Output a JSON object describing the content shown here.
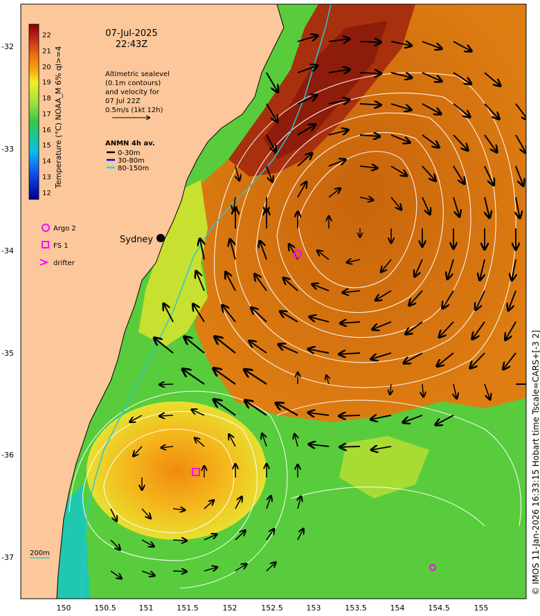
{
  "title": {
    "date": "07-Jul-2025",
    "time": "22:43Z"
  },
  "info": {
    "line1": "Altimetric sealevel",
    "line2": "(0.1m contours)",
    "line3": "and velocity for",
    "line4": "07 Jul 22Z",
    "scale": "0.5m/s (1kt 12h)"
  },
  "anmn": {
    "title": "ANMN 4h av.",
    "items": [
      {
        "label": "0-30m",
        "color": "#000000"
      },
      {
        "label": "30-80m",
        "color": "#0000ff"
      },
      {
        "label": "80-150m",
        "color": "#00e5e5"
      }
    ]
  },
  "colorbar": {
    "label": "Temperature (°C) NOAA_M 6% ql>=4",
    "ticks": [
      "22",
      "21",
      "20",
      "19",
      "18",
      "17",
      "16",
      "15",
      "14",
      "13",
      "12"
    ]
  },
  "legend": [
    {
      "label": "Argo 2",
      "symbol": "circle"
    },
    {
      "label": "FS 1",
      "symbol": "square"
    },
    {
      "label": "drifter",
      "symbol": "chevron"
    }
  ],
  "places": {
    "sydney": "Sydney"
  },
  "isobath": "200m",
  "axes": {
    "x_ticks": [
      "150",
      "150.5",
      "151",
      "151.5",
      "152",
      "152.5",
      "153",
      "153.5",
      "154",
      "154.5",
      "155"
    ],
    "y_ticks": [
      "-32",
      "-33",
      "-34",
      "-35",
      "-36",
      "-37"
    ]
  },
  "credit": "© IMOS 11-Jan-2026 16:33:15 Hobart time Tscale=CARS+[-3 2]",
  "colors": {
    "land": "#fbc79b",
    "warm": "#d8770c",
    "hot": "#a0240c",
    "cool": "#4ec83c",
    "marker": "#ff00ff"
  }
}
